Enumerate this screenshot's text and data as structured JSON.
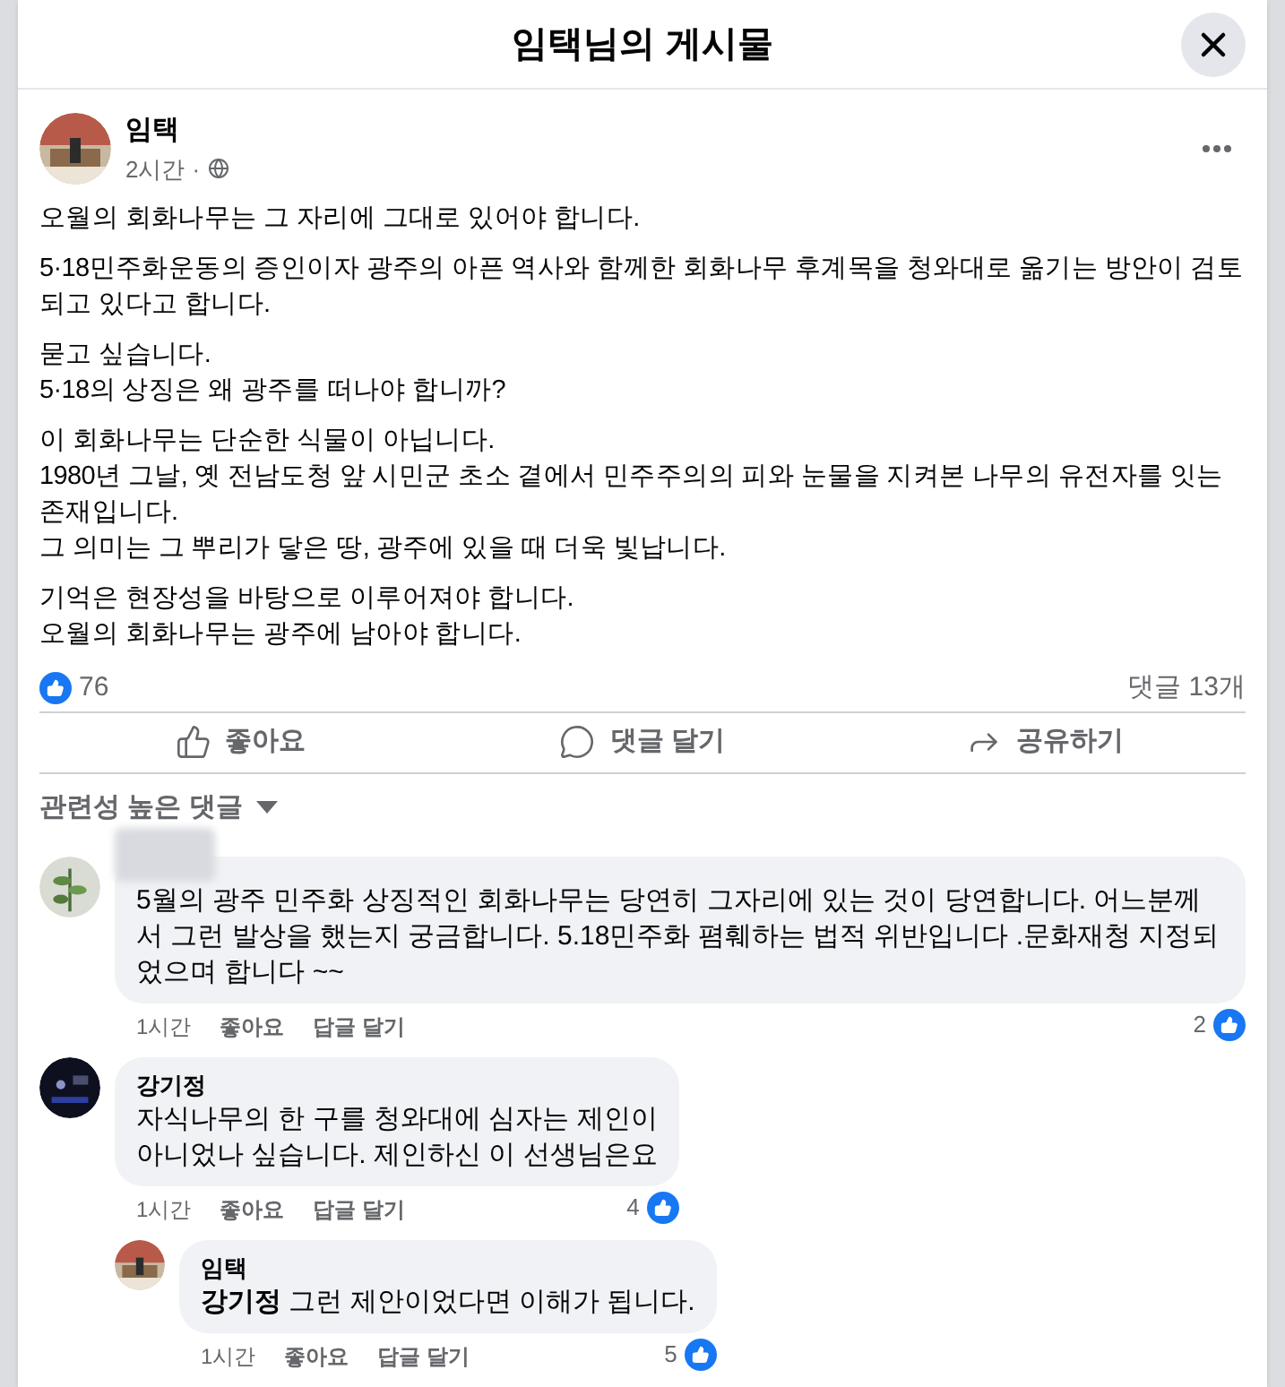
{
  "dialog": {
    "title": "임택님의 게시물"
  },
  "post": {
    "author": "임택",
    "time": "2시간",
    "separator": "·",
    "paragraphs": [
      [
        "오월의 회화나무는 그 자리에 그대로 있어야 합니다."
      ],
      [
        "5·18민주화운동의 증인이자 광주의 아픈 역사와 함께한 회화나무 후계목을 청와대로 옮기는 방안이 검토되고 있다고 합니다."
      ],
      [
        "묻고 싶습니다.",
        "5·18의 상징은 왜 광주를 떠나야 합니까?"
      ],
      [
        "이 회화나무는 단순한 식물이 아닙니다.",
        "1980년 그날, 옛 전남도청 앞 시민군 초소 곁에서 민주주의의 피와 눈물을 지켜본 나무의 유전자를 잇는 존재입니다.",
        "그 의미는 그 뿌리가 닿은 땅, 광주에 있을 때 더욱 빛납니다."
      ],
      [
        "기억은 현장성을 바탕으로 이루어져야 합니다.",
        "오월의 회화나무는 광주에 남아야 합니다."
      ]
    ],
    "likes": "76",
    "comment_count": "댓글 13개"
  },
  "actions": [
    "좋아요",
    "댓글 달기",
    "공유하기"
  ],
  "sort": {
    "label": "관련성 높은 댓글"
  },
  "comments": [
    {
      "author_blurred": true,
      "text": "5월의 광주 민주화 상징적인 회화나무는 당연히 그자리에 있는 것이 당연합니다. 어느분께서 그런 발상을 했는지 궁금합니다. 5.18민주화 폄훼하는 법적 위반입니다 .문화재청 지정되었으며 합니다 ~~",
      "time": "1시간",
      "like": "좋아요",
      "reply": "답글 달기",
      "likes": "2"
    },
    {
      "author_blurred": false,
      "author": "강기정",
      "text": "자식나무의 한 구를 청와대에 심자는 제인이\n아니었나 싶습니다. 제인하신 이 선생님은요",
      "time": "1시간",
      "like": "좋아요",
      "reply": "답글 달기",
      "likes": "4",
      "children": [
        {
          "author_blurred": false,
          "author": "임택",
          "text": "**강기정** 그런 제안이었다면 이해가 됩니다.",
          "time": "1시간",
          "like": "좋아요",
          "reply": "답글 달기",
          "likes": "5"
        }
      ]
    }
  ]
}
